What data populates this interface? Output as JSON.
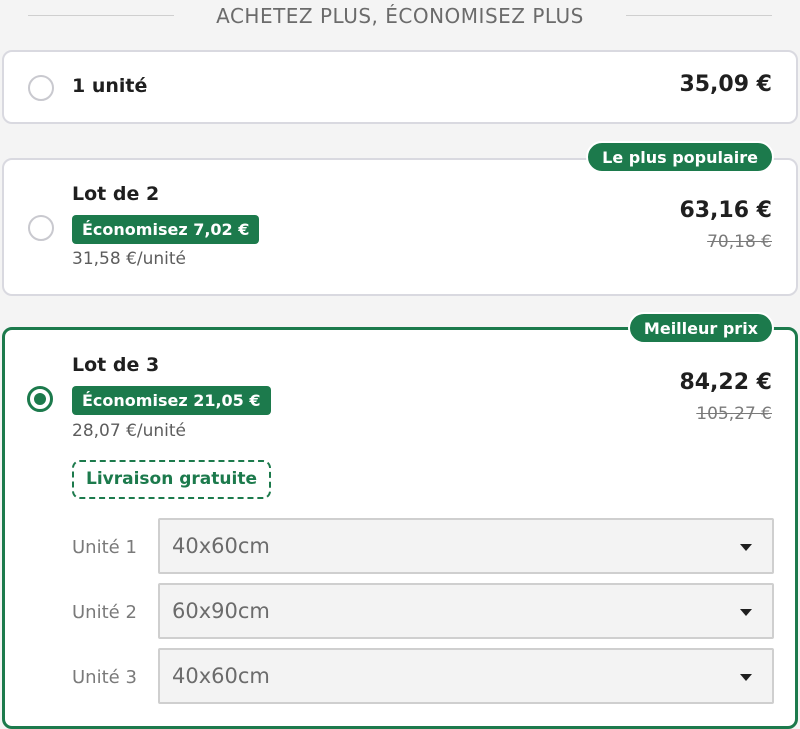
{
  "header": {
    "title": "ACHETEZ PLUS, ÉCONOMISEZ PLUS"
  },
  "options": [
    {
      "title": "1 unité",
      "price": "35,09 €"
    },
    {
      "title": "Lot de 2",
      "badge": "Économisez 7,02 €",
      "unit_price": "31,58 €/unité",
      "price": "63,16 €",
      "old_price": "70,18 €",
      "ribbon": "Le plus populaire"
    },
    {
      "title": "Lot de 3",
      "badge": "Économisez 21,05 €",
      "unit_price": "28,07 €/unité",
      "price": "84,22 €",
      "old_price": "105,27 €",
      "ribbon": "Meilleur prix",
      "free_shipping": "Livraison gratuite",
      "units": [
        {
          "label": "Unité 1",
          "value": "40x60cm"
        },
        {
          "label": "Unité 2",
          "value": "60x90cm"
        },
        {
          "label": "Unité 3",
          "value": "40x60cm"
        }
      ]
    }
  ],
  "selected_option": "Lot de 3",
  "colors": {
    "accent": "#1c7a4c",
    "card_border": "#d9d9e0",
    "background": "#f4f4f4"
  }
}
